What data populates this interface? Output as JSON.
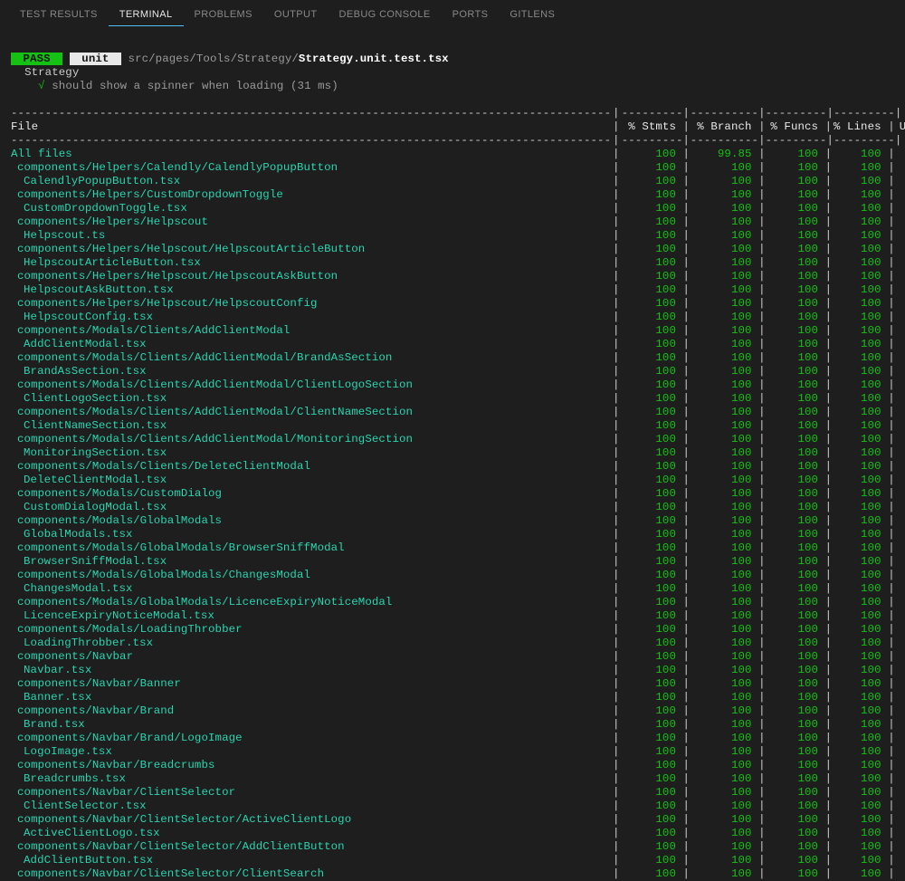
{
  "tabs": [
    {
      "label": "TEST RESULTS",
      "active": false
    },
    {
      "label": "TERMINAL",
      "active": true
    },
    {
      "label": "PROBLEMS",
      "active": false
    },
    {
      "label": "OUTPUT",
      "active": false
    },
    {
      "label": "DEBUG CONSOLE",
      "active": false
    },
    {
      "label": "PORTS",
      "active": false
    },
    {
      "label": "GITLENS",
      "active": false
    }
  ],
  "test_run": {
    "pass_badge": " PASS ",
    "unit_badge": " unit ",
    "path_prefix": "src/pages/Tools/Strategy/",
    "path_file": "Strategy.unit.test.tsx",
    "suite": "Strategy",
    "check": "√",
    "spec": "should show a spinner when loading (31 ms)"
  },
  "coverage_header": {
    "file": "File",
    "stmts": "% Stmts",
    "branch": "% Branch",
    "funcs": "% Funcs",
    "lines": "% Lines",
    "uncovered": "Uncover"
  },
  "coverage_rows": [
    {
      "name": "All files",
      "ind": 0,
      "stm": "100",
      "br": "99.85",
      "fn": "100",
      "ln": "100"
    },
    {
      "name": "components/Helpers/Calendly/CalendlyPopupButton",
      "ind": 1,
      "stm": "100",
      "br": "100",
      "fn": "100",
      "ln": "100"
    },
    {
      "name": "CalendlyPopupButton.tsx",
      "ind": 2,
      "stm": "100",
      "br": "100",
      "fn": "100",
      "ln": "100"
    },
    {
      "name": "components/Helpers/CustomDropdownToggle",
      "ind": 1,
      "stm": "100",
      "br": "100",
      "fn": "100",
      "ln": "100"
    },
    {
      "name": "CustomDropdownToggle.tsx",
      "ind": 2,
      "stm": "100",
      "br": "100",
      "fn": "100",
      "ln": "100"
    },
    {
      "name": "components/Helpers/Helpscout",
      "ind": 1,
      "stm": "100",
      "br": "100",
      "fn": "100",
      "ln": "100"
    },
    {
      "name": "Helpscout.ts",
      "ind": 2,
      "stm": "100",
      "br": "100",
      "fn": "100",
      "ln": "100"
    },
    {
      "name": "components/Helpers/Helpscout/HelpscoutArticleButton",
      "ind": 1,
      "stm": "100",
      "br": "100",
      "fn": "100",
      "ln": "100"
    },
    {
      "name": "HelpscoutArticleButton.tsx",
      "ind": 2,
      "stm": "100",
      "br": "100",
      "fn": "100",
      "ln": "100"
    },
    {
      "name": "components/Helpers/Helpscout/HelpscoutAskButton",
      "ind": 1,
      "stm": "100",
      "br": "100",
      "fn": "100",
      "ln": "100"
    },
    {
      "name": "HelpscoutAskButton.tsx",
      "ind": 2,
      "stm": "100",
      "br": "100",
      "fn": "100",
      "ln": "100"
    },
    {
      "name": "components/Helpers/Helpscout/HelpscoutConfig",
      "ind": 1,
      "stm": "100",
      "br": "100",
      "fn": "100",
      "ln": "100"
    },
    {
      "name": "HelpscoutConfig.tsx",
      "ind": 2,
      "stm": "100",
      "br": "100",
      "fn": "100",
      "ln": "100"
    },
    {
      "name": "components/Modals/Clients/AddClientModal",
      "ind": 1,
      "stm": "100",
      "br": "100",
      "fn": "100",
      "ln": "100"
    },
    {
      "name": "AddClientModal.tsx",
      "ind": 2,
      "stm": "100",
      "br": "100",
      "fn": "100",
      "ln": "100"
    },
    {
      "name": "components/Modals/Clients/AddClientModal/BrandAsSection",
      "ind": 1,
      "stm": "100",
      "br": "100",
      "fn": "100",
      "ln": "100"
    },
    {
      "name": "BrandAsSection.tsx",
      "ind": 2,
      "stm": "100",
      "br": "100",
      "fn": "100",
      "ln": "100"
    },
    {
      "name": "components/Modals/Clients/AddClientModal/ClientLogoSection",
      "ind": 1,
      "stm": "100",
      "br": "100",
      "fn": "100",
      "ln": "100"
    },
    {
      "name": "ClientLogoSection.tsx",
      "ind": 2,
      "stm": "100",
      "br": "100",
      "fn": "100",
      "ln": "100"
    },
    {
      "name": "components/Modals/Clients/AddClientModal/ClientNameSection",
      "ind": 1,
      "stm": "100",
      "br": "100",
      "fn": "100",
      "ln": "100"
    },
    {
      "name": "ClientNameSection.tsx",
      "ind": 2,
      "stm": "100",
      "br": "100",
      "fn": "100",
      "ln": "100"
    },
    {
      "name": "components/Modals/Clients/AddClientModal/MonitoringSection",
      "ind": 1,
      "stm": "100",
      "br": "100",
      "fn": "100",
      "ln": "100"
    },
    {
      "name": "MonitoringSection.tsx",
      "ind": 2,
      "stm": "100",
      "br": "100",
      "fn": "100",
      "ln": "100"
    },
    {
      "name": "components/Modals/Clients/DeleteClientModal",
      "ind": 1,
      "stm": "100",
      "br": "100",
      "fn": "100",
      "ln": "100"
    },
    {
      "name": "DeleteClientModal.tsx",
      "ind": 2,
      "stm": "100",
      "br": "100",
      "fn": "100",
      "ln": "100"
    },
    {
      "name": "components/Modals/CustomDialog",
      "ind": 1,
      "stm": "100",
      "br": "100",
      "fn": "100",
      "ln": "100"
    },
    {
      "name": "CustomDialogModal.tsx",
      "ind": 2,
      "stm": "100",
      "br": "100",
      "fn": "100",
      "ln": "100"
    },
    {
      "name": "components/Modals/GlobalModals",
      "ind": 1,
      "stm": "100",
      "br": "100",
      "fn": "100",
      "ln": "100"
    },
    {
      "name": "GlobalModals.tsx",
      "ind": 2,
      "stm": "100",
      "br": "100",
      "fn": "100",
      "ln": "100"
    },
    {
      "name": "components/Modals/GlobalModals/BrowserSniffModal",
      "ind": 1,
      "stm": "100",
      "br": "100",
      "fn": "100",
      "ln": "100"
    },
    {
      "name": "BrowserSniffModal.tsx",
      "ind": 2,
      "stm": "100",
      "br": "100",
      "fn": "100",
      "ln": "100"
    },
    {
      "name": "components/Modals/GlobalModals/ChangesModal",
      "ind": 1,
      "stm": "100",
      "br": "100",
      "fn": "100",
      "ln": "100"
    },
    {
      "name": "ChangesModal.tsx",
      "ind": 2,
      "stm": "100",
      "br": "100",
      "fn": "100",
      "ln": "100"
    },
    {
      "name": "components/Modals/GlobalModals/LicenceExpiryNoticeModal",
      "ind": 1,
      "stm": "100",
      "br": "100",
      "fn": "100",
      "ln": "100"
    },
    {
      "name": "LicenceExpiryNoticeModal.tsx",
      "ind": 2,
      "stm": "100",
      "br": "100",
      "fn": "100",
      "ln": "100"
    },
    {
      "name": "components/Modals/LoadingThrobber",
      "ind": 1,
      "stm": "100",
      "br": "100",
      "fn": "100",
      "ln": "100"
    },
    {
      "name": "LoadingThrobber.tsx",
      "ind": 2,
      "stm": "100",
      "br": "100",
      "fn": "100",
      "ln": "100"
    },
    {
      "name": "components/Navbar",
      "ind": 1,
      "stm": "100",
      "br": "100",
      "fn": "100",
      "ln": "100"
    },
    {
      "name": "Navbar.tsx",
      "ind": 2,
      "stm": "100",
      "br": "100",
      "fn": "100",
      "ln": "100"
    },
    {
      "name": "components/Navbar/Banner",
      "ind": 1,
      "stm": "100",
      "br": "100",
      "fn": "100",
      "ln": "100"
    },
    {
      "name": "Banner.tsx",
      "ind": 2,
      "stm": "100",
      "br": "100",
      "fn": "100",
      "ln": "100"
    },
    {
      "name": "components/Navbar/Brand",
      "ind": 1,
      "stm": "100",
      "br": "100",
      "fn": "100",
      "ln": "100"
    },
    {
      "name": "Brand.tsx",
      "ind": 2,
      "stm": "100",
      "br": "100",
      "fn": "100",
      "ln": "100"
    },
    {
      "name": "components/Navbar/Brand/LogoImage",
      "ind": 1,
      "stm": "100",
      "br": "100",
      "fn": "100",
      "ln": "100"
    },
    {
      "name": "LogoImage.tsx",
      "ind": 2,
      "stm": "100",
      "br": "100",
      "fn": "100",
      "ln": "100"
    },
    {
      "name": "components/Navbar/Breadcrumbs",
      "ind": 1,
      "stm": "100",
      "br": "100",
      "fn": "100",
      "ln": "100"
    },
    {
      "name": "Breadcrumbs.tsx",
      "ind": 2,
      "stm": "100",
      "br": "100",
      "fn": "100",
      "ln": "100"
    },
    {
      "name": "components/Navbar/ClientSelector",
      "ind": 1,
      "stm": "100",
      "br": "100",
      "fn": "100",
      "ln": "100"
    },
    {
      "name": "ClientSelector.tsx",
      "ind": 2,
      "stm": "100",
      "br": "100",
      "fn": "100",
      "ln": "100"
    },
    {
      "name": "components/Navbar/ClientSelector/ActiveClientLogo",
      "ind": 1,
      "stm": "100",
      "br": "100",
      "fn": "100",
      "ln": "100"
    },
    {
      "name": "ActiveClientLogo.tsx",
      "ind": 2,
      "stm": "100",
      "br": "100",
      "fn": "100",
      "ln": "100"
    },
    {
      "name": "components/Navbar/ClientSelector/AddClientButton",
      "ind": 1,
      "stm": "100",
      "br": "100",
      "fn": "100",
      "ln": "100"
    },
    {
      "name": "AddClientButton.tsx",
      "ind": 2,
      "stm": "100",
      "br": "100",
      "fn": "100",
      "ln": "100"
    },
    {
      "name": "components/Navbar/ClientSelector/ClientSearch",
      "ind": 1,
      "stm": "100",
      "br": "100",
      "fn": "100",
      "ln": "100"
    }
  ]
}
